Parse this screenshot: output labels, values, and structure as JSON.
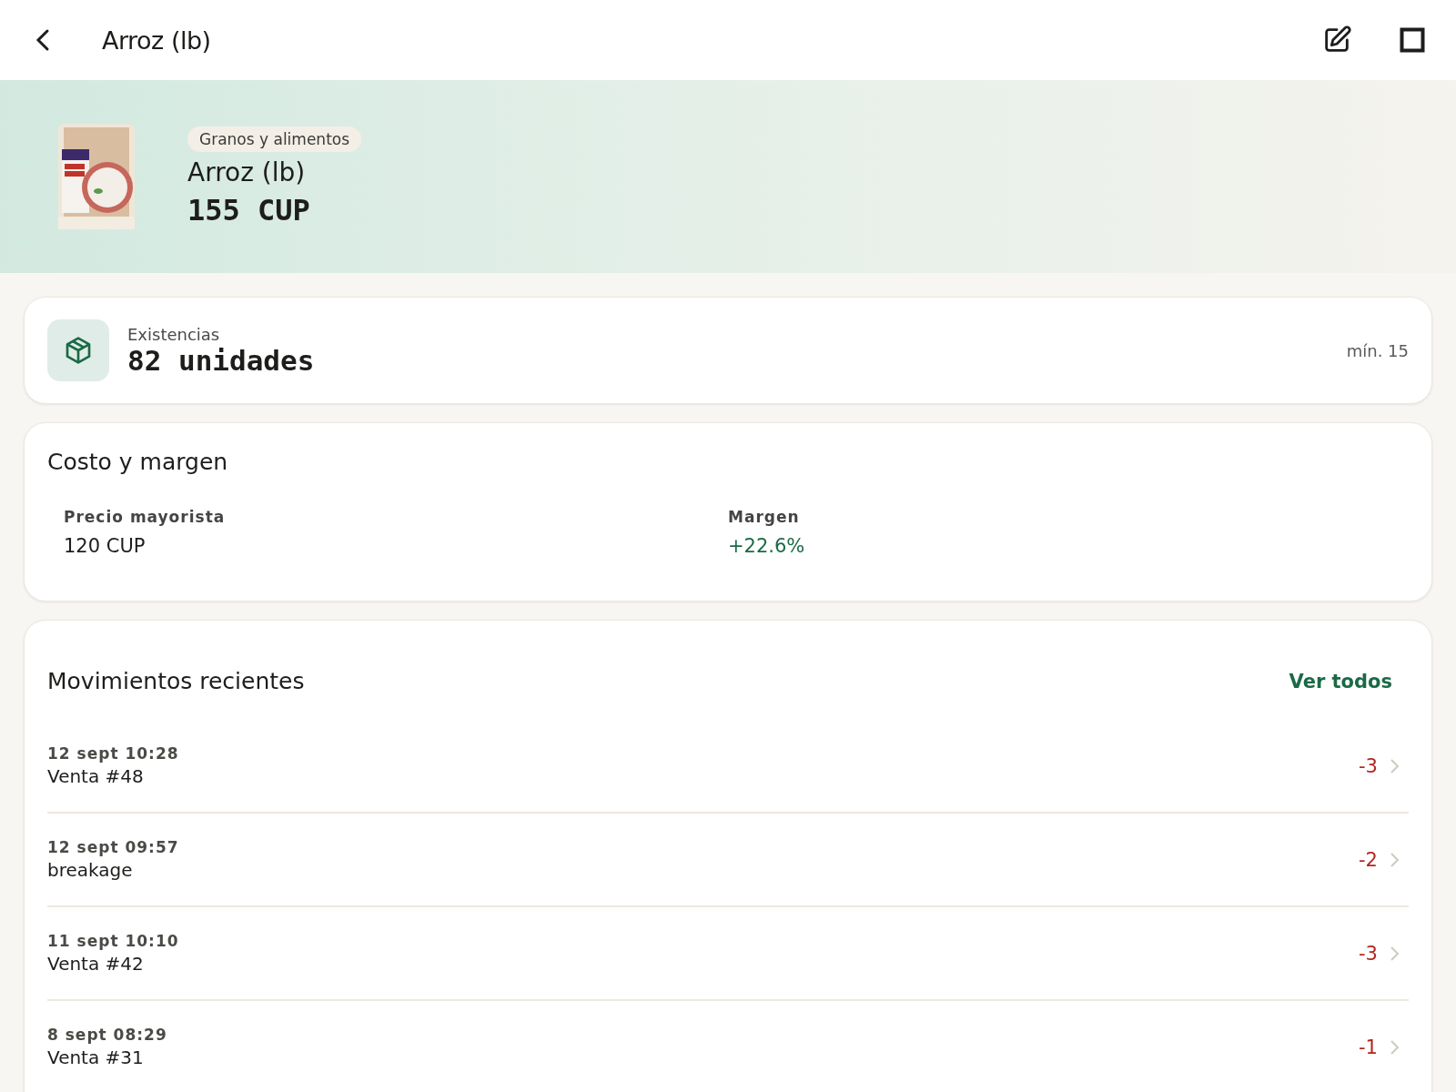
{
  "header": {
    "title": "Arroz (lb)"
  },
  "product": {
    "category": "Granos y alimentos",
    "name": "Arroz (lb)",
    "price": "155 CUP"
  },
  "stock": {
    "label": "Existencias",
    "value": "82 unidades",
    "minimum": "mín. 15"
  },
  "cost": {
    "title": "Costo y margen",
    "fields": [
      {
        "label": "Precio mayorista",
        "value": "120 CUP",
        "kind": "plain"
      },
      {
        "label": "Margen",
        "value": "+22.6%",
        "kind": "positive"
      }
    ]
  },
  "movements": {
    "title": "Movimientos recientes",
    "link": "Ver todos",
    "items": [
      {
        "time": "12 sept 10:28",
        "description": "Venta #48",
        "quantity": "-3"
      },
      {
        "time": "12 sept 09:57",
        "description": "breakage",
        "quantity": "-2"
      },
      {
        "time": "11 sept 10:10",
        "description": "Venta #42",
        "quantity": "-3"
      },
      {
        "time": "8 sept 08:29",
        "description": "Venta #31",
        "quantity": "-1"
      }
    ]
  }
}
